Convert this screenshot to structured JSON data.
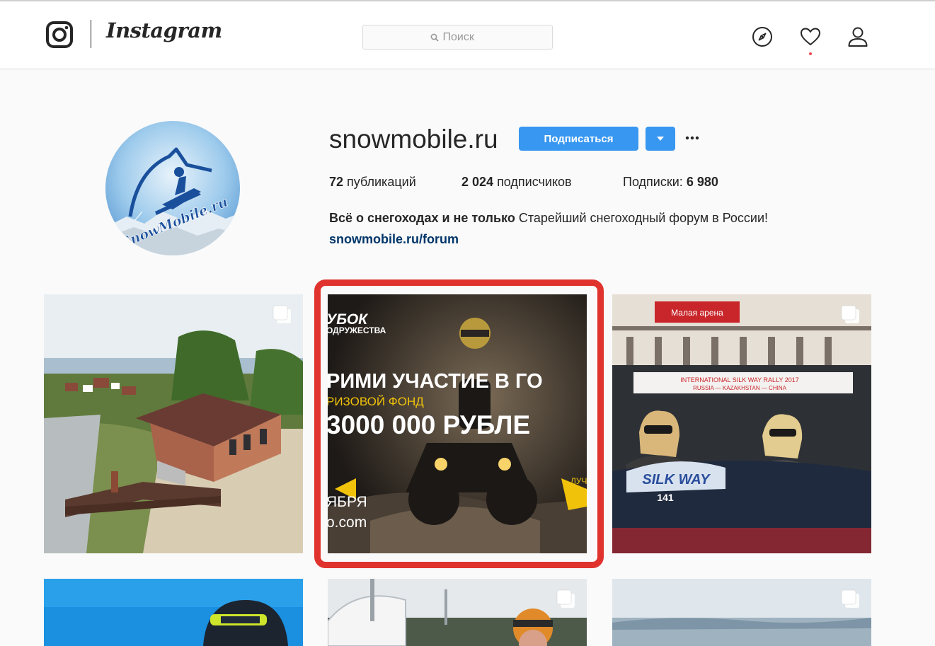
{
  "nav": {
    "brand": "Instagram",
    "search_placeholder": "Поиск",
    "icons": [
      "instagram-glyph-icon",
      "compass-icon",
      "heart-icon",
      "user-icon"
    ],
    "notification_dot_color": "#ed4956"
  },
  "profile": {
    "username": "snowmobile.ru",
    "avatar_text": "SnowMobile.ru",
    "follow_label": "Подписаться",
    "more_label": "···",
    "stats": {
      "posts_count": "72",
      "posts_label": "публикаций",
      "followers_count": "2 024",
      "followers_label": "подписчиков",
      "following_label": "Подписки:",
      "following_count": "6 980"
    },
    "bio_name": "Всё о снегоходах и не только",
    "bio_text": "Старейший снегоходный форум в России!",
    "link": "snowmobile.ru/forum"
  },
  "posts": [
    {
      "id": "post-1",
      "multi": true,
      "description": "house"
    },
    {
      "id": "post-2",
      "multi": false,
      "lines": [
        "УБОК",
        "ОДРУЖЕСТВА",
        "РИМИ УЧАСТИЕ В ГО",
        "РИЗОВОЙ ФОНД",
        "3000 000 РУБЛЕ",
        "ЯБРЯ",
        "o.com",
        "ЛУЧ"
      ]
    },
    {
      "id": "post-3",
      "multi": true,
      "lines": [
        "Малая арена",
        "INTERNATIONAL SILK WAY RALLY 2017",
        "RUSSIA — KAZAKHSTAN — CHINA",
        "SILK WAY",
        "141"
      ]
    },
    {
      "id": "post-4",
      "multi": false
    },
    {
      "id": "post-5",
      "multi": true
    },
    {
      "id": "post-6",
      "multi": true
    }
  ],
  "colors": {
    "accent": "#3897f0",
    "highlight": "#e0332d",
    "link": "#003569"
  }
}
